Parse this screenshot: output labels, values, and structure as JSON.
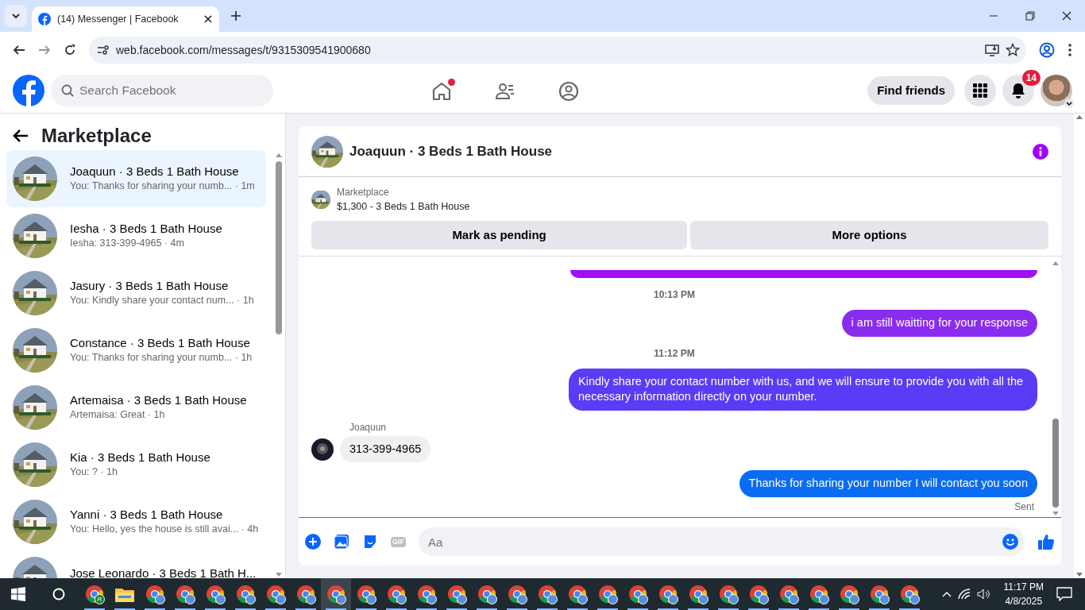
{
  "browser": {
    "tab_title": "(14) Messenger | Facebook",
    "url": "web.facebook.com/messages/t/9315309541900680"
  },
  "header": {
    "search_placeholder": "Search Facebook",
    "nav": [
      {
        "kind": "home",
        "selected": false,
        "dot": true
      },
      {
        "kind": "friends",
        "selected": false,
        "dot": false
      },
      {
        "kind": "groups",
        "selected": false,
        "dot": false
      }
    ],
    "find_friends": "Find friends",
    "notifications": "14"
  },
  "sidebar": {
    "title": "Marketplace",
    "items": [
      {
        "title": "Joaquun · 3 Beds 1 Bath House",
        "snippet": "You: Thanks for sharing your numb... · 1m",
        "selected": true
      },
      {
        "title": "Iesha · 3 Beds 1 Bath House",
        "snippet": "Iesha: 313-399-4965 · 4m",
        "selected": false
      },
      {
        "title": "Jasury · 3 Beds 1 Bath House",
        "snippet": "You: Kindly share your contact num... · 1h",
        "selected": false
      },
      {
        "title": "Constance · 3 Beds 1 Bath House",
        "snippet": "You: Thanks for sharing your numb... · 1h",
        "selected": false
      },
      {
        "title": "Artemaisa · 3 Beds 1 Bath House",
        "snippet": "Artemaisa: Great · 1h",
        "selected": false
      },
      {
        "title": "Kia · 3 Beds 1 Bath House",
        "snippet": "You: ? · 1h",
        "selected": false
      },
      {
        "title": "Yanni · 3 Beds 1 Bath House",
        "snippet": "You: Hello, yes the house is still avai... · 4h",
        "selected": false
      },
      {
        "title": "Jose Leonardo · 3 Beds 1 Bath H...",
        "selected": false
      }
    ]
  },
  "chat": {
    "title": "Joaquun · 3 Beds 1 Bath House",
    "listing": {
      "label": "Marketplace",
      "text": "$1,300 - 3 Beds 1 Bath House"
    },
    "actions": [
      "Mark as pending",
      "More options"
    ],
    "messages": [
      {
        "kind": "edge",
        "color": "#a010f0"
      },
      {
        "kind": "time",
        "text": "10:13 PM"
      },
      {
        "kind": "out",
        "text": "i am still waitting for your response",
        "color": "#8a2cf0"
      },
      {
        "kind": "time",
        "text": "11:12 PM"
      },
      {
        "kind": "out",
        "text": "Kindly share your contact number with us, and we will ensure to provide you with all the necessary information directly on your number.",
        "color": "#5a3cf6"
      },
      {
        "kind": "in",
        "sender": "Joaquun",
        "text": "313-399-4965"
      },
      {
        "kind": "out",
        "text": "Thanks for sharing your number I will contact you soon",
        "color": "#0a6cf2"
      },
      {
        "kind": "status",
        "text": "Sent"
      }
    ],
    "composer": {
      "placeholder": "Aa",
      "gif": "GIF"
    }
  },
  "taskbar": {
    "apps": [
      {
        "kind": "chrome",
        "badge": "R",
        "selected": false
      },
      {
        "kind": "folder",
        "selected": false
      },
      {
        "kind": "chrome",
        "selected": false
      },
      {
        "kind": "chrome",
        "selected": false
      },
      {
        "kind": "chrome",
        "selected": false
      },
      {
        "kind": "chrome",
        "selected": false
      },
      {
        "kind": "chrome",
        "selected": false
      },
      {
        "kind": "chrome",
        "selected": false
      },
      {
        "kind": "chrome",
        "selected": true
      },
      {
        "kind": "chrome",
        "selected": false
      },
      {
        "kind": "chrome",
        "selected": false
      },
      {
        "kind": "chrome",
        "selected": false
      },
      {
        "kind": "chrome",
        "selected": false
      },
      {
        "kind": "chrome",
        "selected": false
      },
      {
        "kind": "chrome",
        "selected": false
      },
      {
        "kind": "chrome",
        "selected": false
      },
      {
        "kind": "chrome",
        "selected": false
      },
      {
        "kind": "chrome",
        "selected": false
      },
      {
        "kind": "chrome",
        "selected": false
      },
      {
        "kind": "chrome",
        "selected": false
      },
      {
        "kind": "chrome",
        "selected": false
      },
      {
        "kind": "chrome",
        "selected": false
      },
      {
        "kind": "chrome",
        "selected": false
      },
      {
        "kind": "chrome",
        "selected": false
      },
      {
        "kind": "chrome",
        "selected": false
      },
      {
        "kind": "chrome",
        "selected": false
      },
      {
        "kind": "chrome",
        "selected": false
      },
      {
        "kind": "chrome",
        "selected": false
      }
    ],
    "time": "11:17 PM",
    "date": "4/8/2025"
  }
}
